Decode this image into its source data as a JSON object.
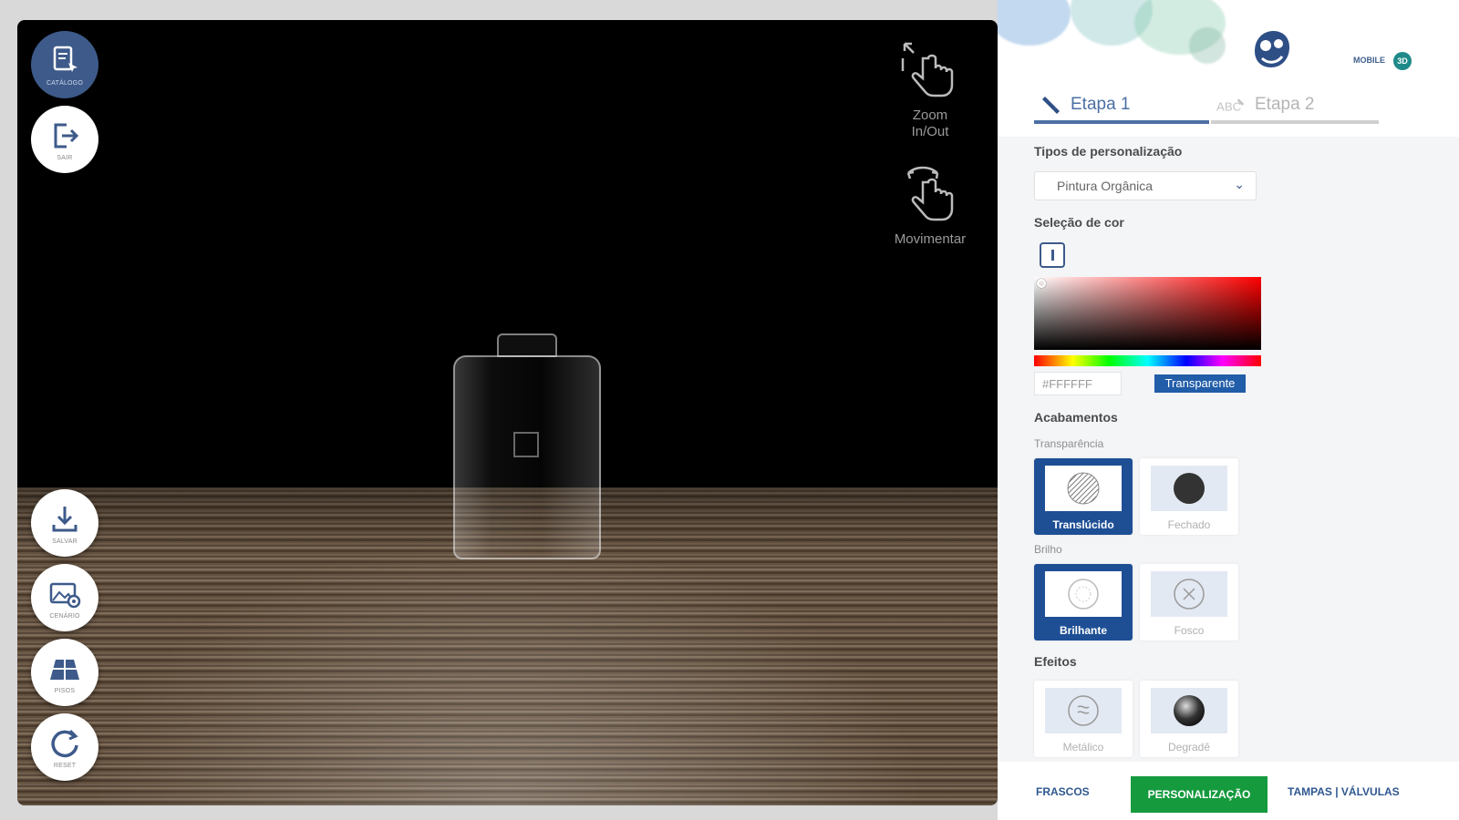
{
  "toolbar": {
    "catalog_label": "Catálogo",
    "exit_label": "Sair",
    "save_label": "Salvar",
    "scene_label": "Cenário",
    "floor_label": "Pisos",
    "reset_label": "Reset"
  },
  "hints": {
    "zoom_label_line1": "Zoom",
    "zoom_label_line2": "In/Out",
    "move_label": "Movimentar"
  },
  "brand": {
    "sub_label": "MOBILE"
  },
  "tabs": [
    {
      "label": "Etapa 1",
      "active": true
    },
    {
      "label": "Etapa 2",
      "active": false
    }
  ],
  "customization": {
    "types_title": "Tipos de personalização",
    "selected_type": "Pintura Orgânica",
    "color_title": "Seleção de cor",
    "hex_value": "#FFFFFF",
    "transparent_label": "Transparente",
    "finishes_title": "Acabamentos",
    "transparency_subtitle": "Transparência",
    "transparency_options": [
      {
        "label": "Translúcido",
        "selected": true
      },
      {
        "label": "Fechado",
        "selected": false
      }
    ],
    "gloss_subtitle": "Brilho",
    "gloss_options": [
      {
        "label": "Brilhante",
        "selected": true
      },
      {
        "label": "Fosco",
        "selected": false
      }
    ],
    "effects_title": "Efeitos",
    "effect_options": [
      {
        "label": "Metálico",
        "selected": false
      },
      {
        "label": "Degradê",
        "selected": false
      }
    ]
  },
  "bottom_nav": {
    "bottles": "FRASCOS",
    "personalization": "PERSONALIZAÇÃO",
    "caps": "TAMPAS | VÁLVULAS"
  },
  "colors": {
    "primary": "#1e4f95",
    "accent_green": "#159a3e",
    "tab_active": "#4b6fa3"
  }
}
